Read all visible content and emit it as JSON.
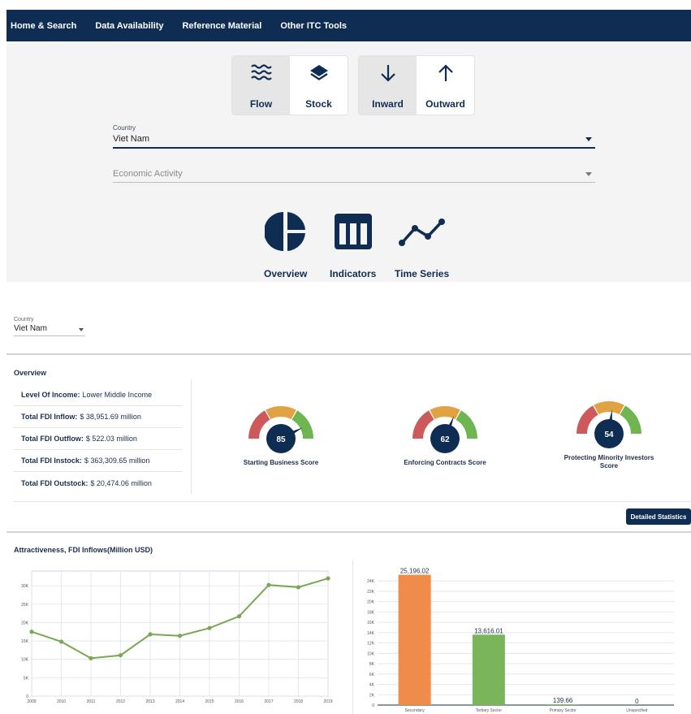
{
  "nav": {
    "items": [
      "Home & Search",
      "Data Availability",
      "Reference Material",
      "Other ITC Tools"
    ]
  },
  "flow_toggle": {
    "flow": "Flow",
    "stock": "Stock",
    "selected": "Flow"
  },
  "direction_toggle": {
    "inward": "Inward",
    "outward": "Outward",
    "selected": "Inward"
  },
  "country_field": {
    "label": "Country",
    "value": "Viet Nam"
  },
  "activity_field": {
    "placeholder": "Economic Activity"
  },
  "views": {
    "overview": "Overview",
    "indicators": "Indicators",
    "time_series": "Time Series"
  },
  "country_small": {
    "label": "Country",
    "value": "Viet Nam"
  },
  "overview": {
    "title": "Overview",
    "stats": [
      {
        "label": "Level Of Income:",
        "value": "Lower Middle Income"
      },
      {
        "label": "Total FDI Inflow:",
        "value": "$ 38,951.69 million"
      },
      {
        "label": "Total FDI Outflow:",
        "value": "$ 522.03 million"
      },
      {
        "label": "Total FDI Instock:",
        "value": "$ 363,309.65 million"
      },
      {
        "label": "Total FDI Outstock:",
        "value": "$ 20,474.06 million"
      }
    ],
    "gauges": [
      {
        "label": "Starting Business Score",
        "value": 85
      },
      {
        "label": "Enforcing Contracts Score",
        "value": 62
      },
      {
        "label": "Protecting Minority Investors Score",
        "value": 54
      }
    ],
    "detail_button": "Detailed Statistics"
  },
  "gauge_colors": {
    "low": "#cc5a5a",
    "mid": "#e0a243",
    "high": "#6fb551",
    "needle": "#0f2d52"
  },
  "attractiveness": {
    "title": "Attractiveness, FDI Inflows(Million USD)"
  },
  "chart_data": [
    {
      "type": "line",
      "x": [
        "2009",
        "2010",
        "2011",
        "2012",
        "2013",
        "2014",
        "2015",
        "2016",
        "2017",
        "2018",
        "2019"
      ],
      "series": [
        {
          "values": [
            17500,
            14800,
            10300,
            11100,
            16800,
            16400,
            18500,
            21700,
            30200,
            29600,
            32000
          ],
          "color": "#7aa655"
        }
      ],
      "y_ticks": [
        "0",
        "5K",
        "10K",
        "15K",
        "20K",
        "25K",
        "30K"
      ],
      "ylim": [
        0,
        34000
      ],
      "grid": true
    },
    {
      "type": "bar",
      "categories": [
        "Secondary",
        "Tertiary Sector",
        "Primary Sector",
        "Unspecified"
      ],
      "values": [
        25196.02,
        13616.01,
        139.66,
        0
      ],
      "value_labels": [
        "25,196.02",
        "13,616.01",
        "139.66",
        "0"
      ],
      "colors": [
        "#ef8c4a",
        "#7ab55c",
        "#7ab55c",
        "#7ab55c"
      ],
      "y_ticks": [
        "0",
        "2K",
        "4K",
        "6K",
        "8K",
        "10K",
        "12K",
        "14K",
        "16K",
        "18K",
        "20K",
        "22K",
        "24K"
      ],
      "ylim": [
        0,
        25600
      ],
      "grid": true
    }
  ]
}
